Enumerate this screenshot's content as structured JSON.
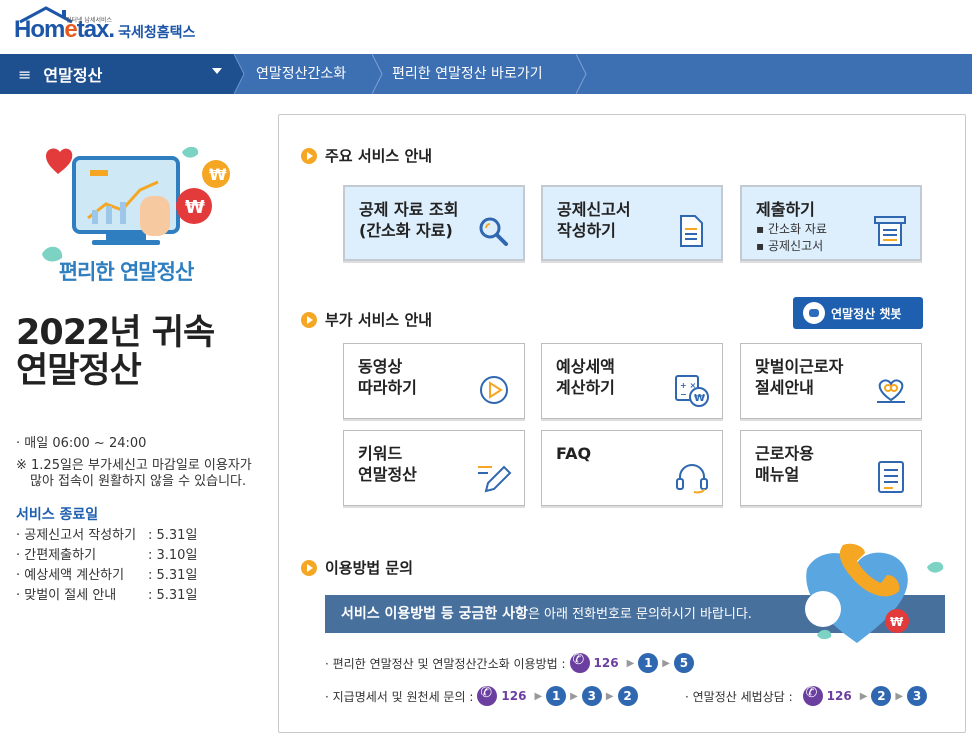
{
  "header": {
    "logo_small_text": "인터넷 납세서비스",
    "logo_word_a": "Hom",
    "logo_word_b": "e",
    "logo_word_c": "tax.",
    "logo_org": "국세청홈택스"
  },
  "nav": {
    "menu_label": "연말정산",
    "crumbs": [
      "연말정산간소화",
      "편리한 연말정산 바로가기"
    ]
  },
  "left": {
    "hero_caption": "편리한 연말정산",
    "title_line1": "2022년 귀속",
    "title_line2": "연말정산",
    "hours": "· 매일 06:00  ~ 24:00",
    "note_line1": "※ 1.25일은 부가세신고 마감일로 이용자가",
    "note_line2": "많아 접속이 원활하지 않을 수 있습니다.",
    "end_title": "서비스 종료일",
    "end_items": [
      {
        "name": "· 공제신고서 작성하기",
        "date": ": 5.31일"
      },
      {
        "name": "· 간편제출하기",
        "date": ": 3.10일"
      },
      {
        "name": "· 예상세액 계산하기",
        "date": ": 5.31일"
      },
      {
        "name": "· 맞벌이 절세 안내",
        "date": ": 5.31일"
      }
    ]
  },
  "main_services": {
    "title": "주요 서비스 안내",
    "cards": [
      {
        "line1": "공제 자료 조회",
        "line2": "(간소화 자료)",
        "icon": "magnifier-icon"
      },
      {
        "line1": "공제신고서",
        "line2": "작성하기",
        "icon": "document-icon"
      },
      {
        "line1": "제출하기",
        "sub1": "▪ 간소화 자료",
        "sub2": "▪ 공제신고서",
        "icon": "submit-tray-icon"
      }
    ]
  },
  "extra_services": {
    "title": "부가 서비스 안내",
    "chatbot_label": "연말정산 챗봇",
    "cards": [
      {
        "line1": "동영상",
        "line2": "따라하기",
        "icon": "play-icon"
      },
      {
        "line1": "예상세액",
        "line2": "계산하기",
        "icon": "calculator-icon"
      },
      {
        "line1": "맞벌이근로자",
        "line2": "절세안내",
        "icon": "heart-hands-icon"
      },
      {
        "line1": "키워드",
        "line2": "연말정산",
        "icon": "pencil-icon"
      },
      {
        "line1": "FAQ",
        "line2": "",
        "icon": "headset-icon"
      },
      {
        "line1": "근로자용",
        "line2": "매뉴얼",
        "icon": "manual-icon"
      }
    ]
  },
  "inquiry": {
    "title": "이용방법 문의",
    "banner_bold": "서비스 이용방법 등 궁금한 사항",
    "banner_rest": "은 아래 전화번호로 문의하시기 바랍니다.",
    "row1_label": "· 편리한 연말정산 및 연말정산간소화 이용방법 :",
    "row1_num": "126",
    "row1_steps": [
      "1",
      "5"
    ],
    "row2_label": "· 지급명세서  및 원천세 문의 :",
    "row2_num": "126",
    "row2_steps": [
      "1",
      "3",
      "2"
    ],
    "row3_label": "· 연말정산 세법상담  :",
    "row3_num": "126",
    "row3_steps": [
      "2",
      "3"
    ]
  },
  "colors": {
    "brand_blue": "#1e5fb0",
    "nav_blue": "#3d6fb3",
    "accent_orange": "#f5a623",
    "phone_purple": "#6b3fa0"
  }
}
